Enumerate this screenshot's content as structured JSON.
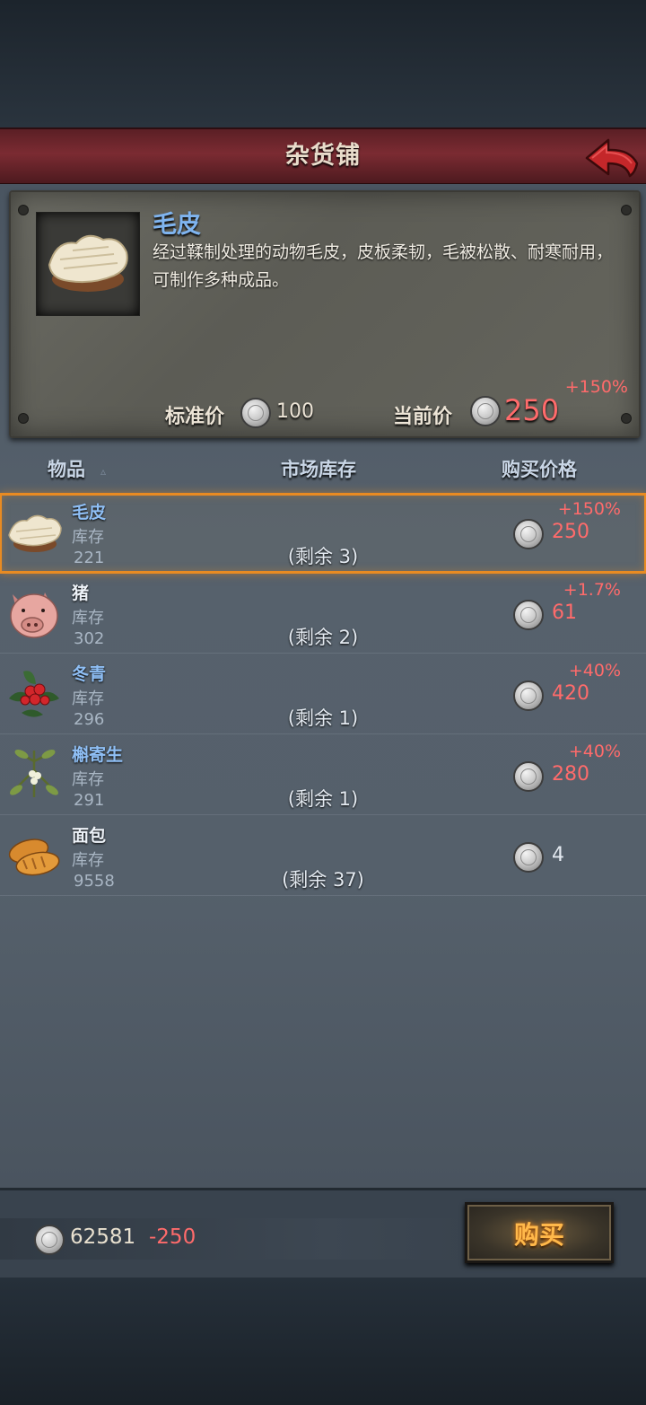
{
  "title": "杂货铺",
  "detail": {
    "name": "毛皮",
    "description": "经过鞣制处理的动物毛皮，皮板柔韧，毛被松散、耐寒耐用，可制作多种成品。",
    "standard_price_label": "标准价",
    "standard_price": "100",
    "current_price_label": "当前价",
    "current_price": "250",
    "current_price_change": "+150%"
  },
  "columns": {
    "item": "物品",
    "stock": "市场库存",
    "price": "购买价格"
  },
  "rows": [
    {
      "name": "毛皮",
      "stock_label": "库存",
      "stock": "221",
      "remaining": "(剩余 3)",
      "change": "+150%",
      "price": "250",
      "icon": "fur-icon"
    },
    {
      "name": "猪",
      "stock_label": "库存",
      "stock": "302",
      "remaining": "(剩余 2)",
      "change": "+1.7%",
      "price": "61",
      "icon": "pig-icon"
    },
    {
      "name": "冬青",
      "stock_label": "库存",
      "stock": "296",
      "remaining": "(剩余 1)",
      "change": "+40%",
      "price": "420",
      "icon": "holly-icon"
    },
    {
      "name": "槲寄生",
      "stock_label": "库存",
      "stock": "291",
      "remaining": "(剩余 1)",
      "change": "+40%",
      "price": "280",
      "icon": "mistletoe-icon"
    },
    {
      "name": "面包",
      "stock_label": "库存",
      "stock": "9558",
      "remaining": "(剩余 37)",
      "change": "",
      "price": "4",
      "icon": "bread-icon"
    }
  ],
  "footer": {
    "money": "62581",
    "money_delta": "-250",
    "buy_label": "购买"
  },
  "colors": {
    "accent_red": "#ff6b6b",
    "name_blue": "#8fbff5",
    "selection": "#e98b22",
    "buy_text": "#ffb84a"
  }
}
